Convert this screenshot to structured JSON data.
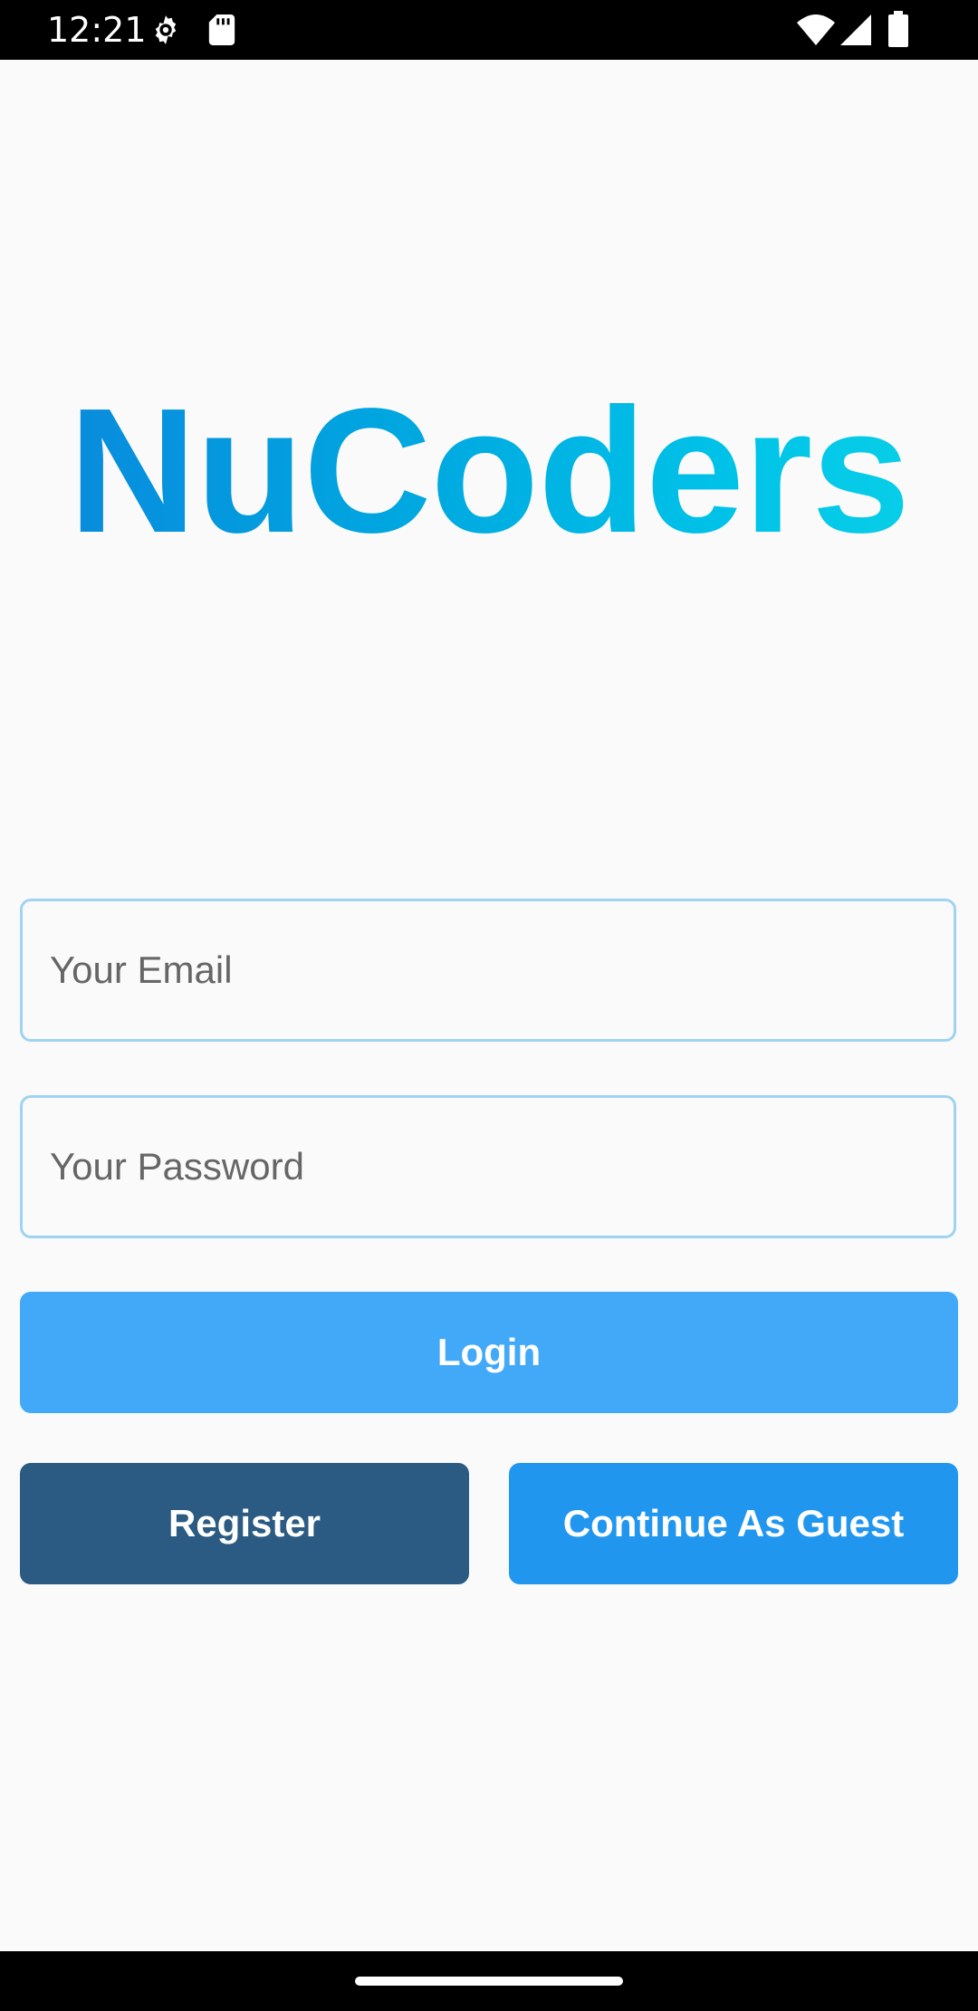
{
  "status_bar": {
    "time": "12:21",
    "icons": [
      "gear-icon",
      "sd-card-icon",
      "wifi-icon",
      "signal-icon",
      "battery-icon"
    ]
  },
  "logo": {
    "text": "NuCoders",
    "gradient_colors": [
      "#0a86dc",
      "#0bd2e8"
    ]
  },
  "form": {
    "email_placeholder": "Your Email",
    "email_value": "",
    "password_placeholder": "Your Password",
    "password_value": ""
  },
  "buttons": {
    "login": "Login",
    "register": "Register",
    "guest": "Continue As Guest"
  },
  "colors": {
    "field_border": "#9fd3f1",
    "login_bg": "#42a9f8",
    "register_bg": "#2b5a82",
    "guest_bg": "#2196ef",
    "background": "#fafafa"
  }
}
